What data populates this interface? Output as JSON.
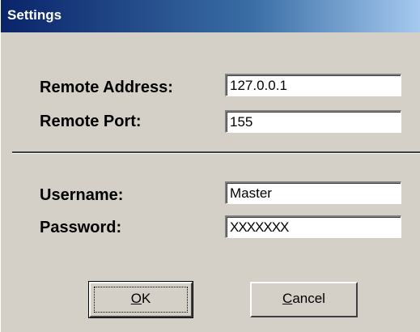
{
  "window": {
    "title": "Settings"
  },
  "connection": {
    "remote_address_label": "Remote Address:",
    "remote_address_value": "127.0.0.1",
    "remote_port_label": "Remote Port:",
    "remote_port_value": "155"
  },
  "credentials": {
    "username_label": "Username:",
    "username_value": "Master",
    "password_label": "Password:",
    "password_value": "XXXXXXX"
  },
  "buttons": {
    "ok_label": "OK",
    "cancel_label": "Cancel"
  },
  "colors": {
    "dialog_background": "#d4d0c8",
    "titlebar_start": "#0a246a",
    "titlebar_end": "#a6caf0"
  }
}
